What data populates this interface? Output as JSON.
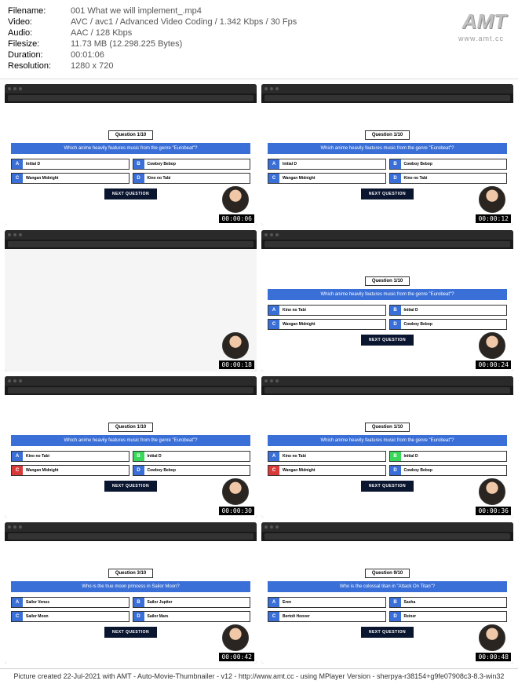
{
  "meta": {
    "filename_label": "Filename:",
    "filename": "001 What we will implement_.mp4",
    "video_label": "Video:",
    "video": "AVC / avc1 / Advanced Video Coding / 1.342 Kbps / 30 Fps",
    "audio_label": "Audio:",
    "audio": "AAC / 128 Kbps",
    "filesize_label": "Filesize:",
    "filesize": "11.73 MB (12.298.225 Bytes)",
    "duration_label": "Duration:",
    "duration": "00:01:06",
    "resolution_label": "Resolution:",
    "resolution": "1280 x 720"
  },
  "watermark": {
    "logo": "AMT",
    "url": "www.amt.cc"
  },
  "quiz": {
    "q110": "Question 1/10",
    "q310": "Question 3/10",
    "q910": "Question 9/10",
    "eurobeat": "Which anime heavily features music from the genre \"Eurobeat\"?",
    "sailor": "Who is the true moon princess in Sailor Moon?",
    "titan": "Who is the colossal titan in \"Attack On Titan\"?",
    "next": "NEXT QUESTION",
    "a": "A",
    "b": "B",
    "c": "C",
    "d": "D",
    "initiald": "Initial D",
    "cowboy": "Cowboy Bebop",
    "wangan": "Wangan Midnight",
    "kino": "Kino no Tabi",
    "svenus": "Sailor Venus",
    "sjupiter": "Sailor Jupiter",
    "smoon": "Sailor Moon",
    "smars": "Sailor Mars",
    "eren": "Eren",
    "sasha": "Sasha",
    "bertolt": "Bertolt Hoover",
    "reiner": "Reiner"
  },
  "ts": [
    "00:00:06",
    "00:00:12",
    "00:00:18",
    "00:00:24",
    "00:00:30",
    "00:00:36",
    "00:00:42",
    "00:00:48"
  ],
  "footer": "Picture created 22-Jul-2021 with AMT - Auto-Movie-Thumbnailer - v12 - http://www.amt.cc - using MPlayer Version - sherpya-r38154+g9fe07908c3-8.3-win32"
}
